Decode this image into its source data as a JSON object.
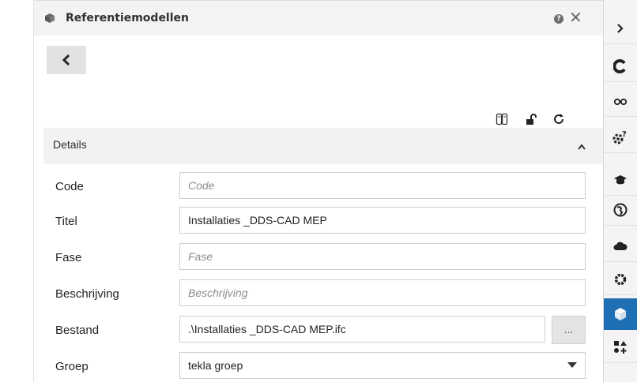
{
  "panel": {
    "title": "Referentiemodellen",
    "icons": {
      "title": "cube-icon",
      "help": "help-icon",
      "close": "close-icon",
      "back": "chevron-left-icon",
      "toolbar": [
        "reference-files-icon",
        "unlock-icon",
        "refresh-icon"
      ]
    },
    "help_glyph": "?",
    "close_glyph": "✕"
  },
  "details": {
    "label": "Details",
    "toggle_icon": "chevron-up-icon",
    "fields": {
      "code": {
        "label": "Code",
        "value": "",
        "placeholder": "Code"
      },
      "titel": {
        "label": "Titel",
        "value": "Installaties _DDS-CAD MEP",
        "placeholder": ""
      },
      "fase": {
        "label": "Fase",
        "value": "",
        "placeholder": "Fase"
      },
      "beschrijving": {
        "label": "Beschrijving",
        "value": "",
        "placeholder": "Beschrijving"
      },
      "bestand": {
        "label": "Bestand",
        "value": ".\\Installaties _DDS-CAD MEP.ifc",
        "browse_label": "..."
      },
      "groep": {
        "label": "Groep",
        "value": "tekla groep"
      }
    }
  },
  "sidebar": {
    "items": [
      {
        "icon": "chevron-right-icon",
        "active": false
      },
      {
        "icon": "tekla-logo-icon",
        "active": false
      },
      {
        "icon": "view-glasses-icon",
        "active": false
      },
      {
        "icon": "settings-question-icon",
        "active": false
      },
      {
        "icon": "graduation-cap-icon",
        "active": false
      },
      {
        "icon": "globe-icon",
        "active": false
      },
      {
        "icon": "cloud-icon",
        "active": false
      },
      {
        "icon": "gear-icon",
        "active": false
      },
      {
        "icon": "cube-icon",
        "active": true
      },
      {
        "icon": "shapes-add-icon",
        "active": false
      }
    ]
  },
  "colors": {
    "accent": "#1f6fb5",
    "titlebar": "#f3f3f3",
    "section": "#f2f2f2"
  }
}
